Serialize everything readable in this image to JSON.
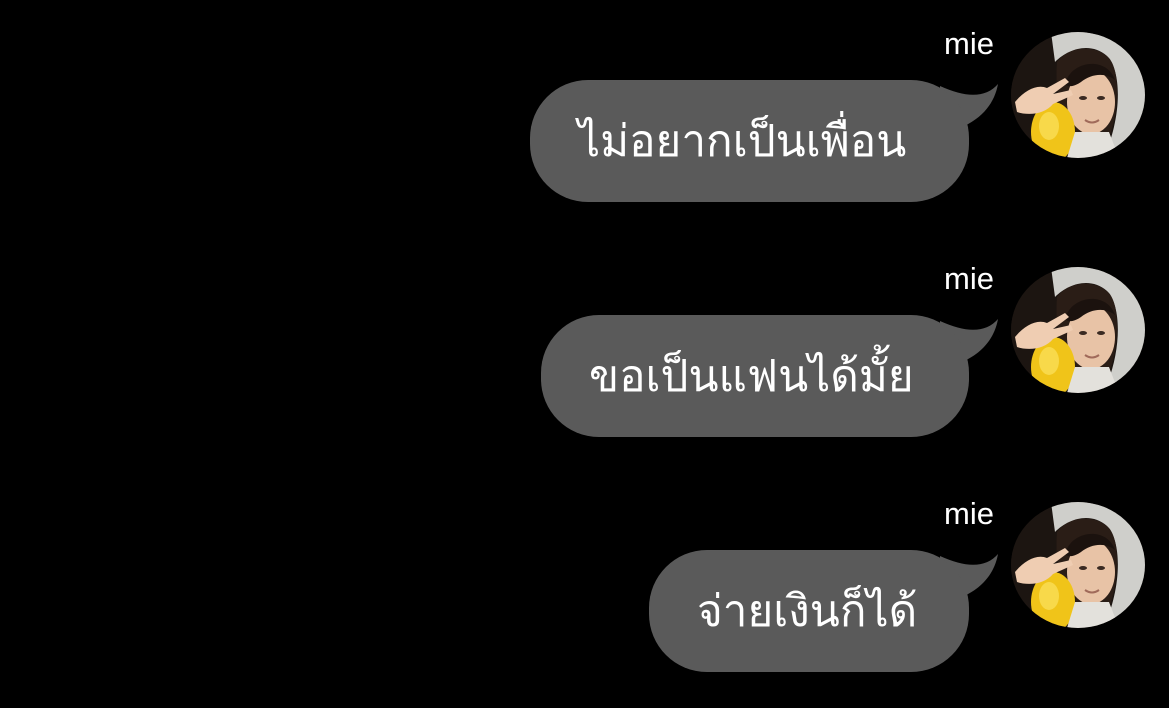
{
  "theme": {
    "background": "#000000",
    "bubble_color": "#5a5a5a",
    "text_color": "#ffffff"
  },
  "messages": [
    {
      "sender": "mie",
      "text": "ไม่อยากเป็นเพื่อน",
      "avatar_icon": "avatar-photo-icon"
    },
    {
      "sender": "mie",
      "text": "ขอเป็นแฟนได้มั้ย",
      "avatar_icon": "avatar-photo-icon"
    },
    {
      "sender": "mie",
      "text": "จ่ายเงินก็ได้",
      "avatar_icon": "avatar-photo-icon"
    }
  ]
}
